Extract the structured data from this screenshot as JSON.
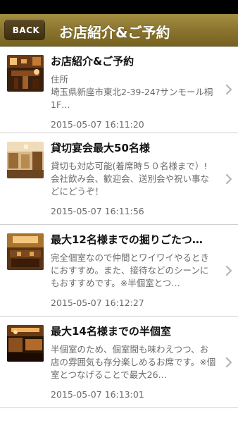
{
  "nav": {
    "back_label": "BACK",
    "title": "お店紹介&ご予約"
  },
  "items": [
    {
      "title": "お店紹介&ご予約",
      "desc": "住所\n埼玉県新座市東北2-39-24?サンモール桐1F…",
      "date": "2015-05-07 16:11:20",
      "thumb_icon": "restaurant-interior-photo"
    },
    {
      "title": "貸切宴会最大50名様",
      "desc": "貸切も対応可能(着席時５０名様まで）! 会社飲み会、歓迎会、送別会や祝い事などにどうぞ！",
      "date": "2015-05-07 16:11:56",
      "thumb_icon": "dining-room-photo"
    },
    {
      "title": "最大12名様までの掘りごたつ…",
      "desc": "完全個室なので仲間とワイワイやるときにおすすめ。また、接待などのシーンにもおすすめです。※半個室とつ…",
      "date": "2015-05-07 16:12:27",
      "thumb_icon": "private-room-photo"
    },
    {
      "title": "最大14名様までの半個室",
      "desc": "半個室のため、個室間も味わえつつ、お店の雰囲気も存分楽しめるお席です。※個室とつなげることで最大26…",
      "date": "2015-05-07 16:13:01",
      "thumb_icon": "semi-private-room-photo"
    }
  ]
}
